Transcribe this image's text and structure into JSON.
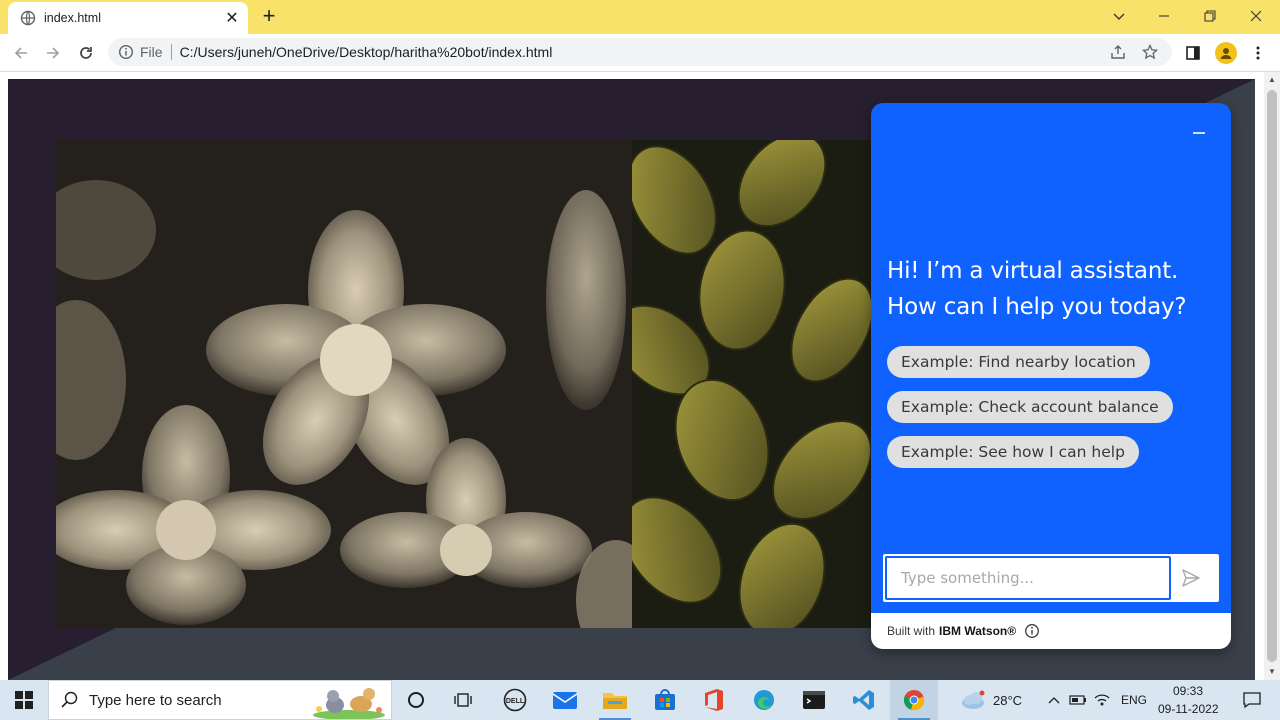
{
  "browser": {
    "tab_title": "index.html",
    "url_scheme_label": "File",
    "url": "C:/Users/juneh/OneDrive/Desktop/haritha%20bot/index.html"
  },
  "chat": {
    "greeting": "Hi! I’m a virtual assistant. How can I help you today?",
    "suggestions": [
      "Example: Find nearby location",
      "Example: Check account balance",
      "Example: See how I can help"
    ],
    "input_placeholder": "Type something...",
    "footer_prefix": "Built with",
    "footer_brand": "IBM Watson®",
    "colors": {
      "accent": "#0f62fe",
      "chip": "#e0e0e0"
    }
  },
  "taskbar": {
    "search_placeholder": "Type here to search",
    "weather": "28°C",
    "language": "ENG",
    "time": "09:33",
    "date": "09-11-2022"
  },
  "colors": {
    "tabbar": "#f9e26a",
    "stage": "#271e30"
  }
}
